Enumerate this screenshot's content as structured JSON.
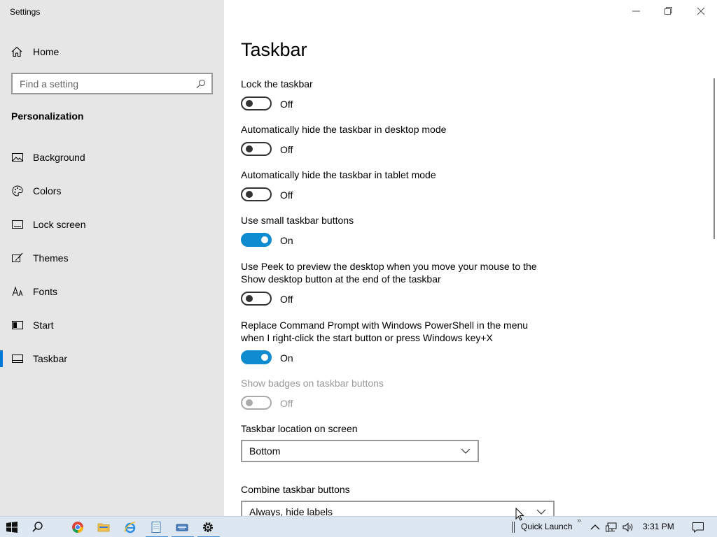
{
  "window": {
    "title": "Settings"
  },
  "sidebar": {
    "home_label": "Home",
    "search_placeholder": "Find a setting",
    "section_title": "Personalization",
    "items": [
      {
        "label": "Background",
        "icon": "picture-icon"
      },
      {
        "label": "Colors",
        "icon": "palette-icon"
      },
      {
        "label": "Lock screen",
        "icon": "lock-screen-icon"
      },
      {
        "label": "Themes",
        "icon": "brush-icon"
      },
      {
        "label": "Fonts",
        "icon": "fonts-icon"
      },
      {
        "label": "Start",
        "icon": "start-icon"
      },
      {
        "label": "Taskbar",
        "icon": "taskbar-icon",
        "active": true
      }
    ]
  },
  "main": {
    "title": "Taskbar",
    "settings": [
      {
        "label": "Lock the taskbar",
        "state": "Off"
      },
      {
        "label": "Automatically hide the taskbar in desktop mode",
        "state": "Off"
      },
      {
        "label": "Automatically hide the taskbar in tablet mode",
        "state": "Off"
      },
      {
        "label": "Use small taskbar buttons",
        "state": "On"
      },
      {
        "label": "Use Peek to preview the desktop when you move your mouse to the Show desktop button at the end of the taskbar",
        "state": "Off"
      },
      {
        "label": "Replace Command Prompt with Windows PowerShell in the menu when I right-click the start button or press Windows key+X",
        "state": "On"
      },
      {
        "label": "Show badges on taskbar buttons",
        "state": "Off",
        "disabled": true
      }
    ],
    "location": {
      "label": "Taskbar location on screen",
      "value": "Bottom"
    },
    "combine": {
      "label": "Combine taskbar buttons",
      "value": "Always, hide labels"
    }
  },
  "taskbar": {
    "toolbar_label": "Quick Launch",
    "overflow": "»",
    "clock": "3:31 PM"
  },
  "colors": {
    "accent": "#0f8cd0",
    "sidebar_bg": "#e6e6e6",
    "taskbar_bg": "#dde7f1"
  }
}
